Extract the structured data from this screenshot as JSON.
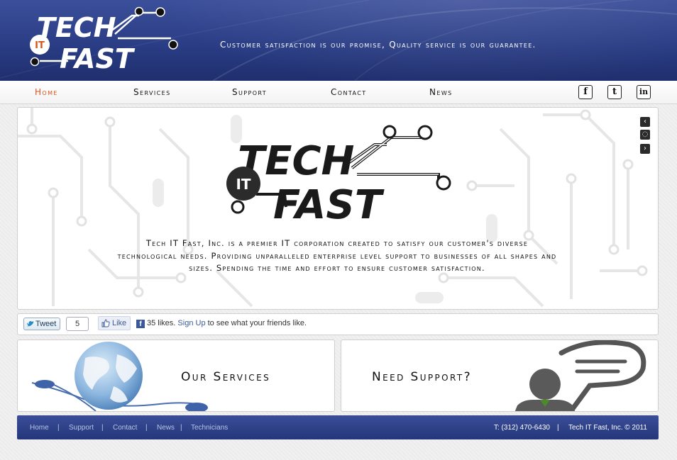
{
  "brand": {
    "logo_line1": "TECH",
    "logo_badge": "IT",
    "logo_line2": "FAST"
  },
  "header": {
    "tagline": "Customer satisfaction is our promise, Quality service is our guarantee."
  },
  "nav": {
    "items": [
      {
        "label": "Home",
        "active": true
      },
      {
        "label": "Services",
        "active": false
      },
      {
        "label": "Support",
        "active": false
      },
      {
        "label": "Contact",
        "active": false
      },
      {
        "label": "News",
        "active": false
      }
    ]
  },
  "social": {
    "facebook": "f",
    "twitter": "t",
    "linkedin": "in"
  },
  "slider": {
    "intro": "Tech IT Fast, Inc. is a premier IT corporation created to satisfy our customer's diverse technological needs. Providing unparalleled enterprise level support to businesses of all shapes and sizes. Spending the time and effort to ensure customer satisfaction.",
    "controls": {
      "prev": "‹",
      "pause": "◌",
      "next": "›"
    }
  },
  "share_bar": {
    "tweet_label": "Tweet",
    "tweet_count": "5",
    "like_label": "Like",
    "likes_text": "35 likes.",
    "signup_link": "Sign Up",
    "signup_suffix": "to see what your friends like."
  },
  "features": {
    "services_title": "Our Services",
    "support_title": "Need Support?"
  },
  "footer": {
    "links": [
      "Home",
      "Support",
      "Contact",
      "News",
      "Technicians"
    ],
    "separator": "|",
    "phone": "T: (312) 470-6430",
    "copyright": "Tech IT Fast, Inc. © 2011"
  },
  "colors": {
    "header_blue": "#2a3d85",
    "accent_orange": "#d9541e",
    "footer_blue": "#2f4288"
  }
}
